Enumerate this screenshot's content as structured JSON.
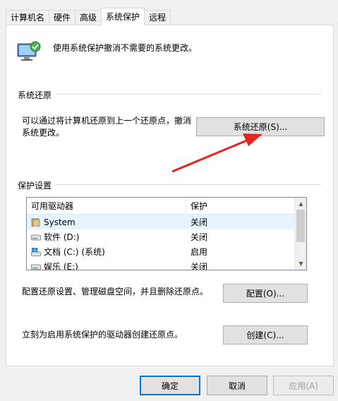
{
  "tabs": [
    "计算机名",
    "硬件",
    "高级",
    "系统保护",
    "远程"
  ],
  "active_tab": 3,
  "header": {
    "text": "使用系统保护撤消不需要的系统更改。"
  },
  "restore": {
    "title": "系统还原",
    "desc_line1": "可以通过将计算机还原到上一个还原点，撤消",
    "desc_line2": "系统更改。",
    "button": "系统还原(S)..."
  },
  "protection": {
    "title": "保护设置",
    "columns": [
      "可用驱动器",
      "保护"
    ],
    "rows": [
      {
        "name": "System",
        "status": "关闭",
        "icon": "folder-drive-icon"
      },
      {
        "name": "软件 (D:)",
        "status": "关闭",
        "icon": "disk-drive-icon"
      },
      {
        "name": "文档 (C:) (系统)",
        "status": "启用",
        "icon": "windows-drive-icon"
      },
      {
        "name": "娱乐 (E:)",
        "status": "关闭",
        "icon": "disk-drive-icon"
      }
    ],
    "configure_desc": "配置还原设置、管理磁盘空间，并且删除还原点。",
    "configure_button": "配置(O)...",
    "create_desc": "立刻为启用系统保护的驱动器创建还原点。",
    "create_button": "创建(C)..."
  },
  "footer": {
    "ok": "确定",
    "cancel": "取消",
    "apply": "应用(A)"
  },
  "colors": {
    "accent": "#0078d7",
    "arrow": "#e8231e"
  }
}
